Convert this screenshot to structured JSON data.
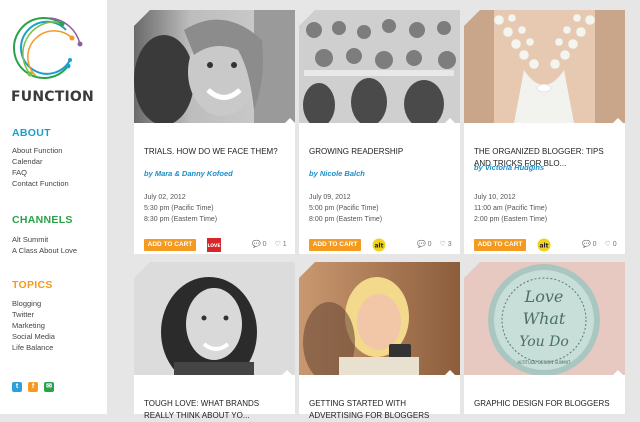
{
  "brand": {
    "name": "FUNCTION"
  },
  "sidebar": {
    "sections": [
      {
        "title": "ABOUT",
        "color": "#1a9fd0",
        "items": [
          "About Function",
          "Calendar",
          "FAQ",
          "Contact Function"
        ]
      },
      {
        "title": "CHANNELS",
        "color": "#2aa24a",
        "items": [
          "Alt Summit",
          "A Class About Love"
        ]
      },
      {
        "title": "TOPICS",
        "color": "#f39a1f",
        "items": [
          "Blogging",
          "Twitter",
          "Marketing",
          "Social Media",
          "Life Balance"
        ]
      }
    ],
    "social": [
      {
        "icon": "twitter-icon",
        "glyph": "t",
        "color": "#2ba0d9"
      },
      {
        "icon": "facebook-icon",
        "glyph": "f",
        "color": "#f39a1f"
      },
      {
        "icon": "email-icon",
        "glyph": "✉",
        "color": "#2aa24a"
      }
    ]
  },
  "cards": [
    {
      "title": "TRIALS. HOW DO WE FACE THEM?",
      "author": "by Mara & Danny Kofoed",
      "date": "July 02, 2012",
      "time_pacific": "5:30 pm (Pacific Time)",
      "time_eastern": "8:30 pm (Eastern Time)",
      "cart_label": "ADD TO CART",
      "badge": "love-badge",
      "comments": "0",
      "likes": "1"
    },
    {
      "title": "GROWING READERSHIP",
      "author": "by Nicole Balch",
      "date": "July 09, 2012",
      "time_pacific": "5:00 pm (Pacific Time)",
      "time_eastern": "8:00 pm (Eastern Time)",
      "cart_label": "ADD TO CART",
      "badge": "alt-badge",
      "comments": "0",
      "likes": "3"
    },
    {
      "title": "THE ORGANIZED BLOGGER: TIPS AND TRICKS FOR BLO...",
      "author": "by Victoria Hudgins",
      "date": "July 10, 2012",
      "time_pacific": "11:00 am (Pacific Time)",
      "time_eastern": "2:00 pm (Eastern Time)",
      "cart_label": "ADD TO CART",
      "badge": "alt-badge",
      "comments": "0",
      "likes": "0"
    },
    {
      "title": "TOUGH LOVE: WHAT BRANDS REALLY THINK ABOUT YO...",
      "author": "",
      "date": "",
      "time_pacific": "",
      "time_eastern": "",
      "cart_label": "",
      "badge": "",
      "comments": "",
      "likes": ""
    },
    {
      "title": "GETTING STARTED WITH ADVERTISING FOR BLOGGERS",
      "author": "",
      "date": "",
      "time_pacific": "",
      "time_eastern": "",
      "cart_label": "",
      "badge": "",
      "comments": "",
      "likes": ""
    },
    {
      "title": "GRAPHIC DESIGN FOR BLOGGERS",
      "author": "",
      "date": "",
      "time_pacific": "",
      "time_eastern": "",
      "cart_label": "",
      "badge": "",
      "comments": "",
      "likes": ""
    }
  ],
  "photo_art": {
    "script_lines": [
      "Love",
      "What",
      "You Do"
    ],
    "ring_text": "ALTITUDE DESIGN SUMMIT"
  },
  "badges": {
    "love_text": "LOVE",
    "alt_text": "alt"
  },
  "colors": {
    "accent_orange": "#f39a1f",
    "link_blue": "#1a8fc9",
    "background": "#e6e6e6"
  }
}
